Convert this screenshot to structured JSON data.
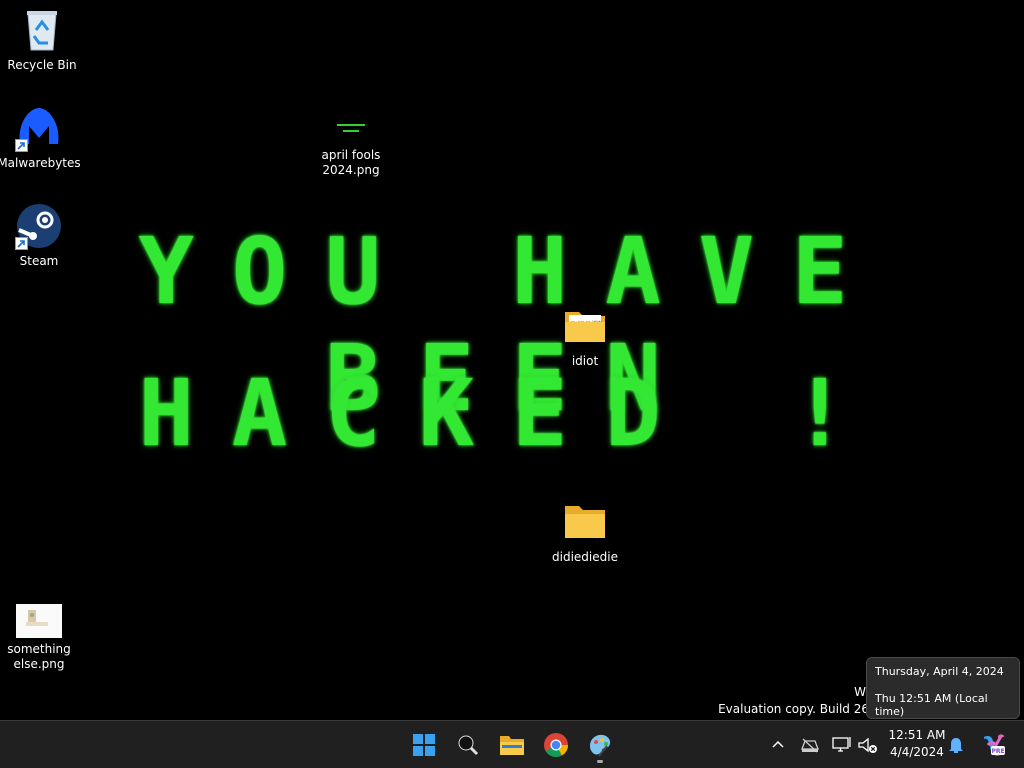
{
  "wallpaper": {
    "line1": "YOU HAVE BEEN",
    "line2": "HACKED !",
    "color": "#33e833"
  },
  "desktop_icons": {
    "recycle_bin": "Recycle Bin",
    "malwarebytes": "Malwarebytes",
    "steam": "Steam",
    "april_fools_line1": "april fools",
    "april_fools_line2": "2024.png",
    "idiot": "idiot",
    "idiot_thumb_text": "you are an idiot",
    "didiediedie": "didiediedie",
    "something_line1": "something",
    "something_line2": "else.png"
  },
  "watermark": {
    "line1": "Wi",
    "line2": "Evaluation copy. Build 26"
  },
  "tooltip": {
    "date_full": "Thursday, April 4, 2024",
    "time_local": "Thu 12:51 AM (Local time)"
  },
  "taskbar": {
    "apps": [
      "start-icon",
      "search-icon",
      "file-explorer-icon",
      "chrome-icon",
      "paint-icon"
    ],
    "clock_time": "12:51 AM",
    "clock_date": "4/4/2024",
    "copilot_badge": "PRE",
    "colors": {
      "background": "#202020",
      "folder": "#f8c94a",
      "start": "#3aa0f0"
    }
  }
}
